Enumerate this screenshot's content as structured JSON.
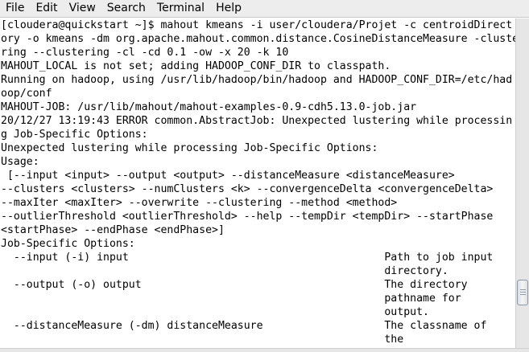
{
  "menu": [
    "File",
    "Edit",
    "View",
    "Search",
    "Terminal",
    "Help"
  ],
  "terminal_lines": [
    "[cloudera@quickstart ~]$ mahout kmeans -i user/cloudera/Projet -c centroidDirect",
    "ory -o kmeans -dm org.apache.mahout.common.distance.CosineDistanceMeasure -cluste",
    "ring --clustering -cl -cd 0.1 -ow -x 20 -k 10",
    "MAHOUT_LOCAL is not set; adding HADOOP_CONF_DIR to classpath.",
    "Running on hadoop, using /usr/lib/hadoop/bin/hadoop and HADOOP_CONF_DIR=/etc/had",
    "oop/conf",
    "MAHOUT-JOB: /usr/lib/mahout/mahout-examples-0.9-cdh5.13.0-job.jar",
    "20/12/27 13:19:43 ERROR common.AbstractJob: Unexpected lustering while processin",
    "g Job-Specific Options:",
    "Unexpected lustering while processing Job-Specific Options:",
    "Usage:",
    " [--input <input> --output <output> --distanceMeasure <distanceMeasure>",
    "--clusters <clusters> --numClusters <k> --convergenceDelta <convergenceDelta>",
    "--maxIter <maxIter> --overwrite --clustering --method <method>",
    "--outlierThreshold <outlierThreshold> --help --tempDir <tempDir> --startPhase",
    "<startPhase> --endPhase <endPhase>]",
    "Job-Specific Options:",
    "  --input (-i) input                                        Path to job input",
    "                                                            directory.",
    "  --output (-o) output                                      The directory",
    "                                                            pathname for",
    "                                                            output.",
    "  --distanceMeasure (-dm) distanceMeasure                   The classname of",
    "                                                            the"
  ]
}
